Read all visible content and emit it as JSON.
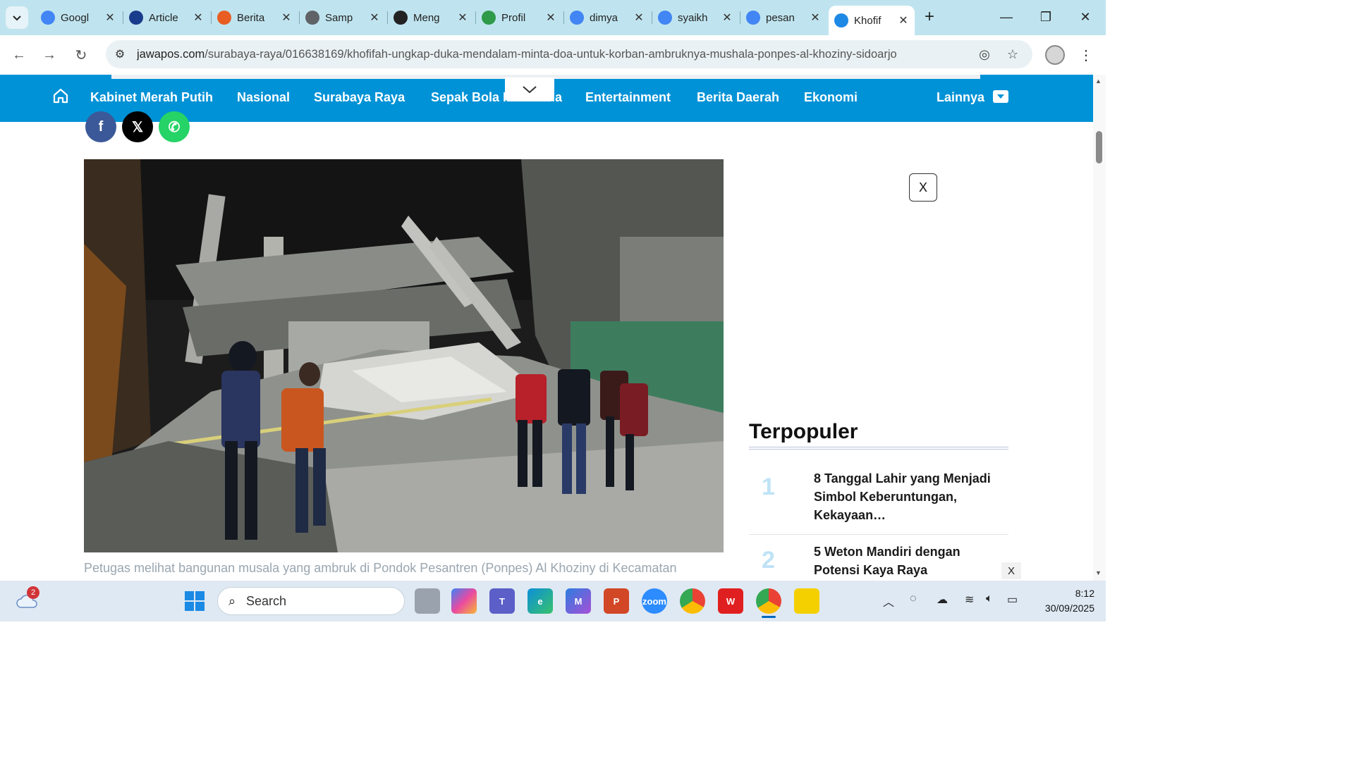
{
  "browser": {
    "tabs": [
      {
        "label": "Googl",
        "icon": "gemini-icon",
        "color": "#4285f4"
      },
      {
        "label": "Article",
        "icon": "ro-icon",
        "color": "#1a3c8c"
      },
      {
        "label": "Berita",
        "icon": "bing-icon",
        "color": "#e85d22"
      },
      {
        "label": "Samp",
        "icon": "globe-icon",
        "color": "#5f6368"
      },
      {
        "label": "Meng",
        "icon": "circle-logo-icon",
        "color": "#222222"
      },
      {
        "label": "Profil",
        "icon": "emblem-icon",
        "color": "#2e9a4a"
      },
      {
        "label": "dimya",
        "icon": "google-icon",
        "color": "#4285f4"
      },
      {
        "label": "syaikh",
        "icon": "google-icon",
        "color": "#4285f4"
      },
      {
        "label": "pesan",
        "icon": "google-icon",
        "color": "#4285f4"
      },
      {
        "label": "Khofif",
        "icon": "jp-icon",
        "color": "#1e88e5"
      }
    ],
    "url_domain": "jawapos.com",
    "url_path": "/surabaya-raya/016638169/khofifah-ungkap-duka-mendalam-minta-doa-untuk-korban-ambruknya-mushala-ponpes-al-khoziny-sidoarjo"
  },
  "site_nav": {
    "items": [
      "Kabinet Merah Putih",
      "Nasional",
      "Surabaya Raya",
      "Sepak Bola Indonesia",
      "Entertainment",
      "Berita Daerah",
      "Ekonomi"
    ],
    "more_label": "Lainnya"
  },
  "share": [
    {
      "icon": "facebook-icon",
      "glyph": "f",
      "color": "#3b5998"
    },
    {
      "icon": "x-icon",
      "glyph": "𝕏",
      "color": "#000000"
    },
    {
      "icon": "whatsapp-icon",
      "glyph": "✆",
      "color": "#25d366"
    }
  ],
  "article": {
    "caption": "Petugas melihat bangunan musala yang ambruk di Pondok Pesantren (Ponpes) Al Khoziny di Kecamatan"
  },
  "ad": {
    "close_label": "X"
  },
  "sidebar": {
    "heading": "Terpopuler",
    "items": [
      {
        "num": "1",
        "title": "8 Tanggal Lahir yang Menjadi Simbol Keberuntungan, Kekayaan…"
      },
      {
        "num": "2",
        "title": "5 Weton Mandiri dengan Potensi Kaya Raya"
      }
    ],
    "small_close": "X"
  },
  "taskbar": {
    "search_label": "Search",
    "weather_badge": "2",
    "time": "8:12",
    "date": "30/09/2025"
  },
  "colors": {
    "nav_blue": "#0092d6",
    "tab_bar": "#bfe4ef"
  }
}
